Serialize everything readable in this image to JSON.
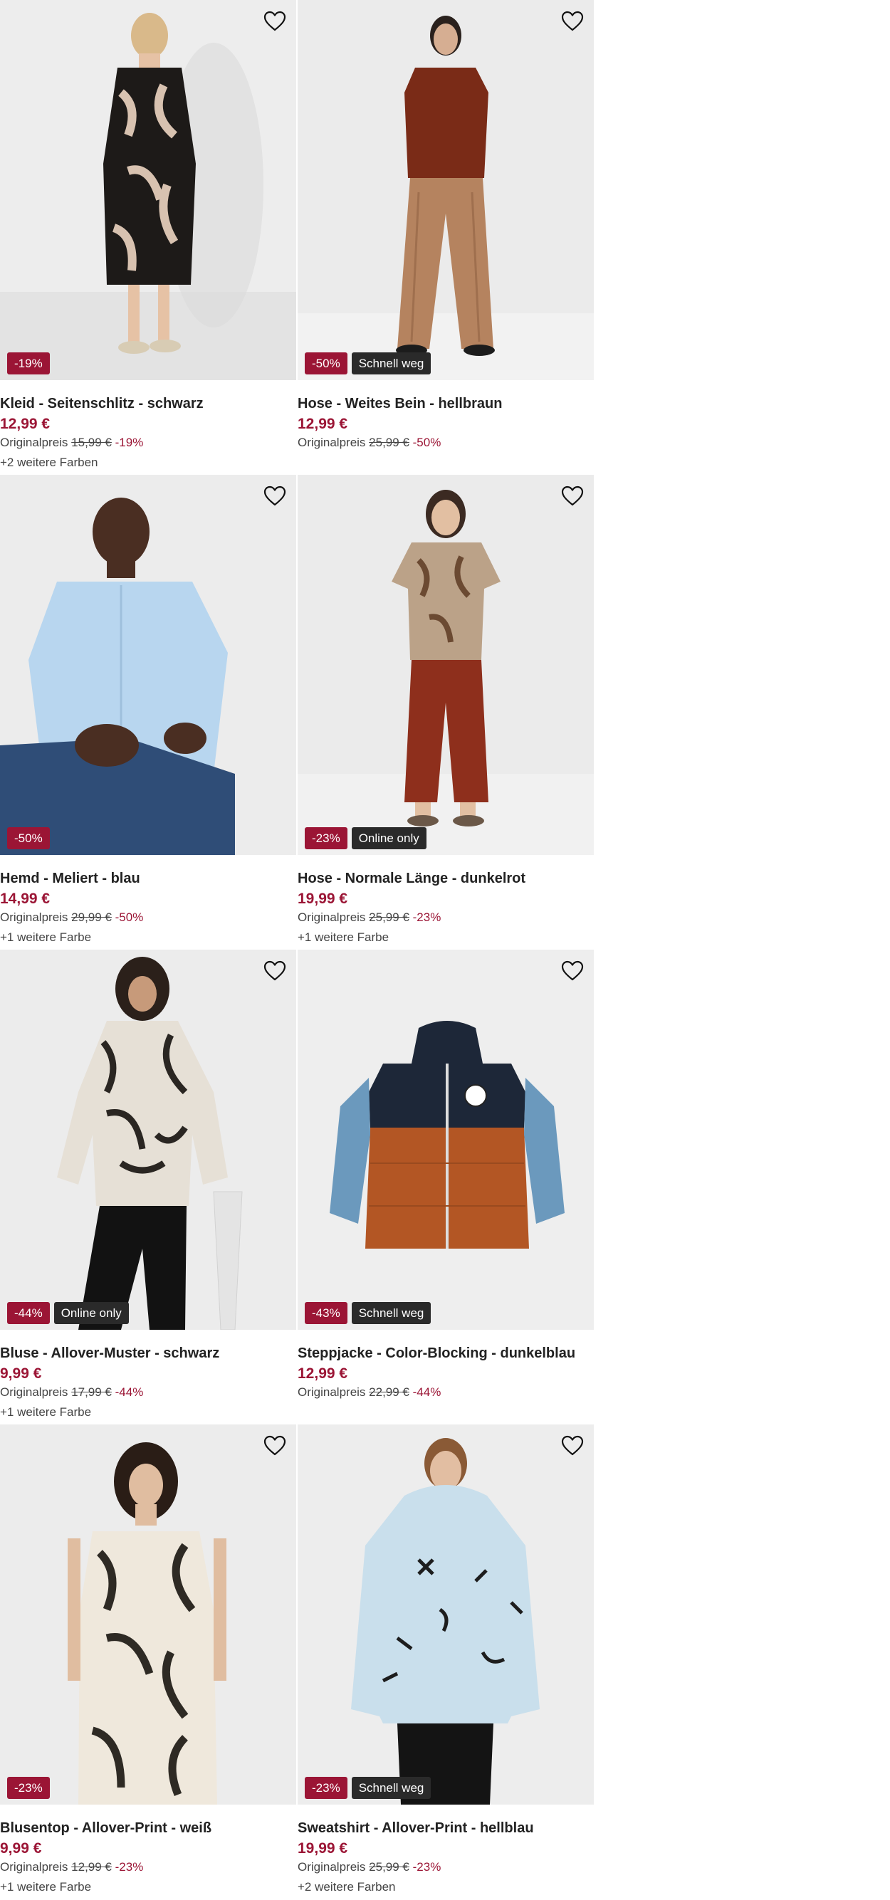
{
  "products": [
    {
      "title": "Kleid - Seitenschlitz - schwarz",
      "price": "12,99 €",
      "orig_label": "Originalpreis",
      "orig_price": "15,99 €",
      "discount": "-19%",
      "badge_discount": "-19%",
      "badge_tag": "",
      "colors": "+2 weitere Farben",
      "image": "dress-palm-print"
    },
    {
      "title": "Hose - Weites Bein - hellbraun",
      "price": "12,99 €",
      "orig_label": "Originalpreis",
      "orig_price": "25,99 €",
      "discount": "-50%",
      "badge_discount": "-50%",
      "badge_tag": "Schnell weg",
      "colors": "",
      "image": "wide-leg-trousers"
    },
    {
      "title": "Hemd - Meliert - blau",
      "price": "14,99 €",
      "orig_label": "Originalpreis",
      "orig_price": "29,99 €",
      "discount": "-50%",
      "badge_discount": "-50%",
      "badge_tag": "",
      "colors": "+1 weitere Farbe",
      "image": "blue-shirt"
    },
    {
      "title": "Hose - Normale Länge - dunkelrot",
      "price": "19,99 €",
      "orig_label": "Originalpreis",
      "orig_price": "25,99 €",
      "discount": "-23%",
      "badge_discount": "-23%",
      "badge_tag": "Online only",
      "colors": "+1 weitere Farbe",
      "image": "red-trousers"
    },
    {
      "title": "Bluse - Allover-Muster - schwarz",
      "price": "9,99 €",
      "orig_label": "Originalpreis",
      "orig_price": "17,99 €",
      "discount": "-44%",
      "badge_discount": "-44%",
      "badge_tag": "Online only",
      "colors": "+1 weitere Farbe",
      "image": "patterned-blouse"
    },
    {
      "title": "Steppjacke - Color-Blocking - dunkelblau",
      "price": "12,99 €",
      "orig_label": "Originalpreis",
      "orig_price": "22,99 €",
      "discount": "-44%",
      "badge_discount": "-43%",
      "badge_tag": "Schnell weg",
      "colors": "",
      "image": "puffer-jacket"
    },
    {
      "title": "Blusentop - Allover-Print - weiß",
      "price": "9,99 €",
      "orig_label": "Originalpreis",
      "orig_price": "12,99 €",
      "discount": "-23%",
      "badge_discount": "-23%",
      "badge_tag": "",
      "colors": "+1 weitere Farbe",
      "image": "palm-print-top"
    },
    {
      "title": "Sweatshirt - Allover-Print - hellblau",
      "price": "19,99 €",
      "orig_label": "Originalpreis",
      "orig_price": "25,99 €",
      "discount": "-23%",
      "badge_discount": "-23%",
      "badge_tag": "Schnell weg",
      "colors": "+2 weitere Farben",
      "image": "printed-hoodie"
    }
  ],
  "icons": {
    "favorite": "heart-outline-icon"
  },
  "colors": {
    "accent": "#9b1535",
    "tag_bg": "#2a2a2a",
    "image_bg": "#ececec"
  }
}
